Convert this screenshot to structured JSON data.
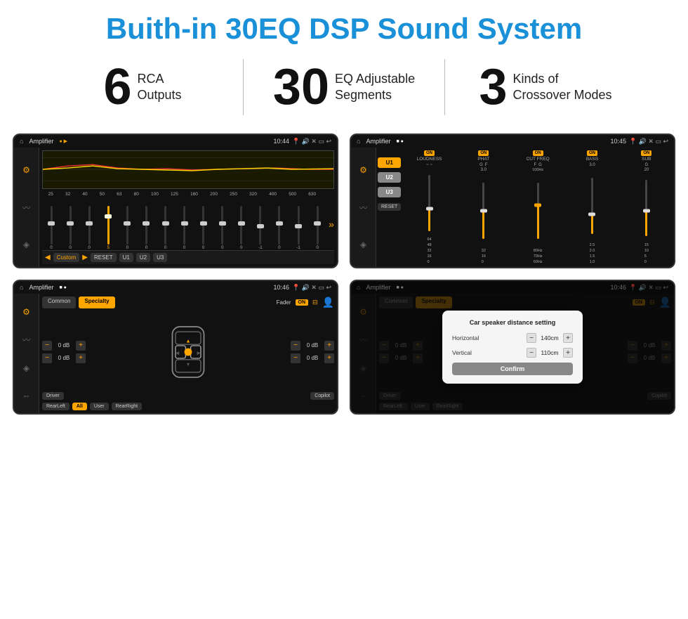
{
  "header": {
    "title": "Buith-in 30EQ DSP Sound System"
  },
  "stats": [
    {
      "number": "6",
      "line1": "RCA",
      "line2": "Outputs"
    },
    {
      "number": "30",
      "line1": "EQ Adjustable",
      "line2": "Segments"
    },
    {
      "number": "3",
      "line1": "Kinds of",
      "line2": "Crossover Modes"
    }
  ],
  "screens": [
    {
      "id": "eq-screen",
      "statusbar": {
        "title": "Amplifier",
        "time": "10:44"
      }
    },
    {
      "id": "crossover-screen",
      "statusbar": {
        "title": "Amplifier",
        "time": "10:45"
      }
    },
    {
      "id": "fader-screen",
      "statusbar": {
        "title": "Amplifier",
        "time": "10:46"
      },
      "tabs": [
        "Common",
        "Specialty"
      ],
      "fader_label": "Fader",
      "on_label": "ON",
      "controls": {
        "driver": "Driver",
        "copilot": "Copilot",
        "rear_left": "RearLeft",
        "all": "All",
        "user": "User",
        "rear_right": "RearRight"
      },
      "db_values": [
        "0 dB",
        "0 dB",
        "0 dB",
        "0 dB"
      ]
    },
    {
      "id": "dialog-screen",
      "statusbar": {
        "title": "Amplifier",
        "time": "10:46"
      },
      "tabs": [
        "Common",
        "Specialty"
      ],
      "dialog": {
        "title": "Car speaker distance setting",
        "horizontal_label": "Horizontal",
        "horizontal_value": "140cm",
        "vertical_label": "Vertical",
        "vertical_value": "110cm",
        "confirm_label": "Confirm"
      },
      "controls": {
        "driver": "Driver",
        "copilot": "Copilot",
        "rear_left": "RearLeft.",
        "user": "User",
        "rear_right": "RearRight"
      },
      "db_values": [
        "0 dB",
        "0 dB"
      ]
    }
  ],
  "eq_freqs": [
    "25",
    "32",
    "40",
    "50",
    "63",
    "80",
    "100",
    "125",
    "160",
    "200",
    "250",
    "320",
    "400",
    "500",
    "630"
  ],
  "eq_values": [
    "0",
    "0",
    "0",
    "5",
    "0",
    "0",
    "0",
    "0",
    "0",
    "0",
    "0",
    "-1",
    "0",
    "-1"
  ],
  "eq_btns": [
    "Custom",
    "RESET",
    "U1",
    "U2",
    "U3"
  ],
  "crossover_strips": [
    {
      "label": "LOUDNESS"
    },
    {
      "label": "PHAT"
    },
    {
      "label": "CUT FREQ"
    },
    {
      "label": "BASS"
    },
    {
      "label": "SUB"
    }
  ],
  "u_buttons": [
    "U1",
    "U2",
    "U3"
  ]
}
